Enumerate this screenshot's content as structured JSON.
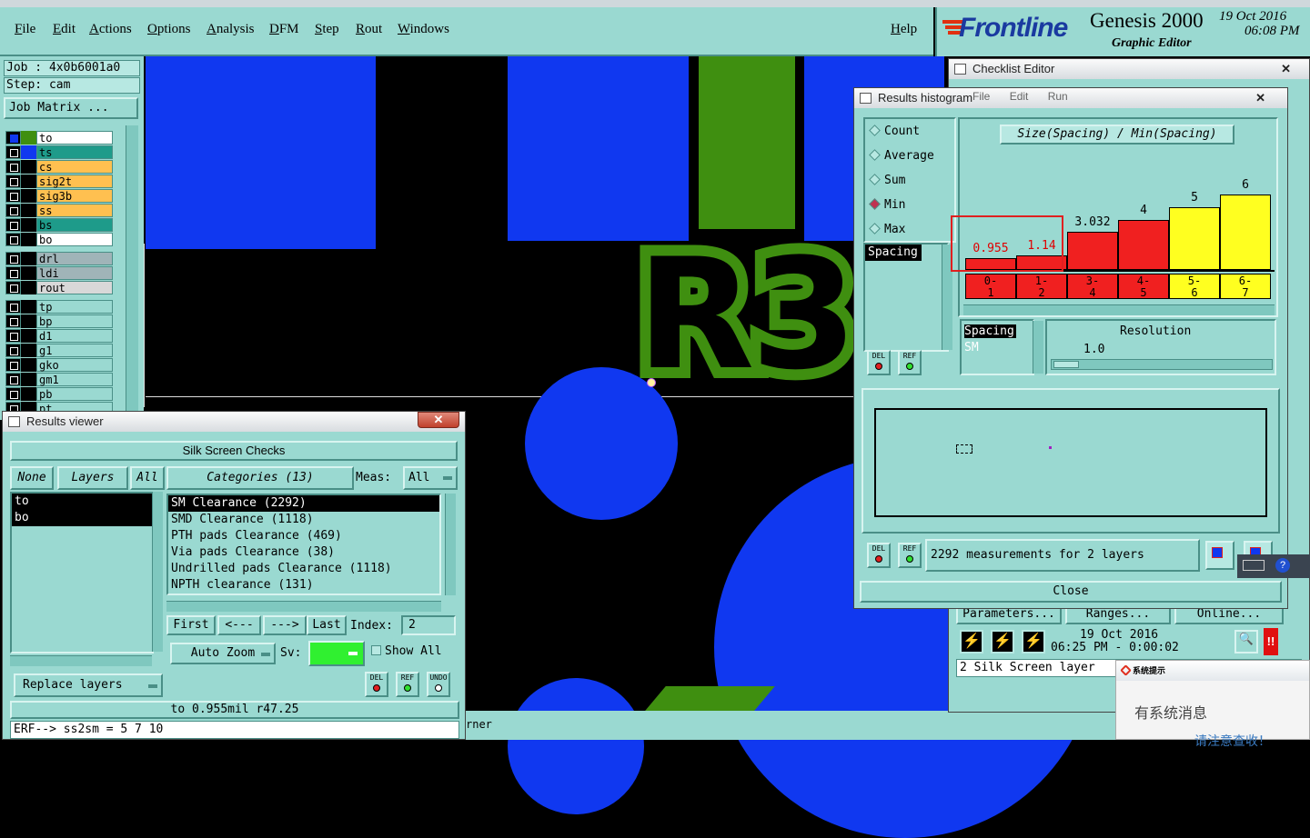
{
  "menubar": {
    "items": [
      "File",
      "Edit",
      "Actions",
      "Options",
      "Analysis",
      "DFM",
      "Step",
      "Rout",
      "Windows"
    ],
    "help": "Help"
  },
  "logo": {
    "brand": "Frontline",
    "product": "Genesis 2000",
    "subtitle": "Graphic Editor",
    "date": "19 Oct 2016",
    "time": "06:08 PM"
  },
  "leftpanel": {
    "job": "Job : 4x0b6001a0",
    "step": "Step: cam",
    "job_matrix": "Job Matrix ...",
    "layers": [
      {
        "name": "to",
        "color": "#ffffff",
        "swatch": "#3f8f10"
      },
      {
        "name": "ts",
        "color": "#1e9b8a",
        "swatch": "#1038f0"
      },
      {
        "name": "cs",
        "color": "#ffc050",
        "swatch": "#000000"
      },
      {
        "name": "sig2t",
        "color": "#ffc050",
        "swatch": "#000000"
      },
      {
        "name": "sig3b",
        "color": "#ffc050",
        "swatch": "#000000"
      },
      {
        "name": "ss",
        "color": "#ffc050",
        "swatch": "#000000"
      },
      {
        "name": "bs",
        "color": "#1e9b8a",
        "swatch": "#000000"
      },
      {
        "name": "bo",
        "color": "#ffffff",
        "swatch": "#000000"
      },
      {
        "name": "drl",
        "color": "#a0b4b8",
        "swatch": "#000000"
      },
      {
        "name": "ldi",
        "color": "#a0b4b8",
        "swatch": "#000000"
      },
      {
        "name": "rout",
        "color": "#d8d8d8",
        "swatch": "#000000"
      },
      {
        "name": "tp",
        "color": "#9ad9d1",
        "swatch": "#000000"
      },
      {
        "name": "bp",
        "color": "#9ad9d1",
        "swatch": "#000000"
      },
      {
        "name": "d1",
        "color": "#9ad9d1",
        "swatch": "#000000"
      },
      {
        "name": "g1",
        "color": "#9ad9d1",
        "swatch": "#000000"
      },
      {
        "name": "gko",
        "color": "#9ad9d1",
        "swatch": "#000000"
      },
      {
        "name": "gm1",
        "color": "#9ad9d1",
        "swatch": "#000000"
      },
      {
        "name": "pb",
        "color": "#9ad9d1",
        "swatch": "#000000"
      },
      {
        "name": "pt",
        "color": "#9ad9d1",
        "swatch": "#000000"
      }
    ]
  },
  "canvas": {
    "silk_text": "R3",
    "bottom_text": "rner"
  },
  "results_viewer": {
    "title": "Results viewer",
    "header": "Silk Screen Checks",
    "none": "None",
    "layers": "Layers",
    "all": "All",
    "layer_list": [
      "to",
      "bo"
    ],
    "categories_label": "Categories (13)",
    "meas_label": "Meas:",
    "meas_value": "All",
    "categories": [
      "SM Clearance (2292)",
      "SMD Clearance (1118)",
      "PTH pads Clearance (469)",
      "Via pads Clearance (38)",
      "Undrilled pads Clearance (1118)",
      "NPTH clearance (131)"
    ],
    "first": "First",
    "prev": "<---",
    "next": "--->",
    "last": "Last",
    "index_label": "Index:",
    "index_value": "2",
    "auto_zoom": "Auto Zoom",
    "sv_label": "Sv:",
    "show_all": "Show All",
    "replace_layers": "Replace layers",
    "del": "DEL",
    "ref": "REF",
    "undo": "UNDO",
    "status": "to 0.955mil  r47.25",
    "erf": "ERF--> ss2sm = 5 7 10"
  },
  "histogram": {
    "title": "Results histogram",
    "menu": [
      "File",
      "Edit",
      "Run"
    ],
    "modes": [
      {
        "label": "Count",
        "selected": false
      },
      {
        "label": "Average",
        "selected": false
      },
      {
        "label": "Sum",
        "selected": false
      },
      {
        "label": "Min",
        "selected": true
      },
      {
        "label": "Max",
        "selected": false
      }
    ],
    "chart_title": "Size(Spacing) / Min(Spacing)",
    "list_item": "Spacing",
    "bars": [
      {
        "range": "0-\n1",
        "label": "0.955",
        "value": 0.955,
        "color": "#f02020",
        "lblcolor": "#e00000"
      },
      {
        "range": "1-\n2",
        "label": "1.14",
        "value": 1.14,
        "color": "#f02020",
        "lblcolor": "#e00000"
      },
      {
        "range": "3-\n4",
        "label": "3.032",
        "value": 3.032,
        "color": "#f02020",
        "lblcolor": "#000000"
      },
      {
        "range": "4-\n5",
        "label": "4",
        "value": 4,
        "color": "#f02020",
        "lblcolor": "#000000"
      },
      {
        "range": "5-\n6",
        "label": "5",
        "value": 5,
        "color": "#ffff20",
        "lblcolor": "#000000"
      },
      {
        "range": "6-\n7",
        "label": "6",
        "value": 6,
        "color": "#ffff20",
        "lblcolor": "#000000"
      }
    ],
    "sel_line1": "Spacing",
    "sel_line2": "SM",
    "resolution_label": "Resolution",
    "resolution_value": "1.0",
    "summary": "2292 measurements for 2 layers",
    "close": "Close",
    "del": "DEL",
    "ref": "REF"
  },
  "checklist": {
    "title": "Checklist Editor",
    "parameters": "Parameters...",
    "ranges": "Ranges...",
    "online": "Online...",
    "date": "19 Oct 2016",
    "time": "06:25 PM - 0:00:02",
    "status": "2 Silk Screen layer"
  },
  "popup": {
    "title": "系统提示",
    "message": "有系统消息",
    "message2": "请注意查收！"
  }
}
